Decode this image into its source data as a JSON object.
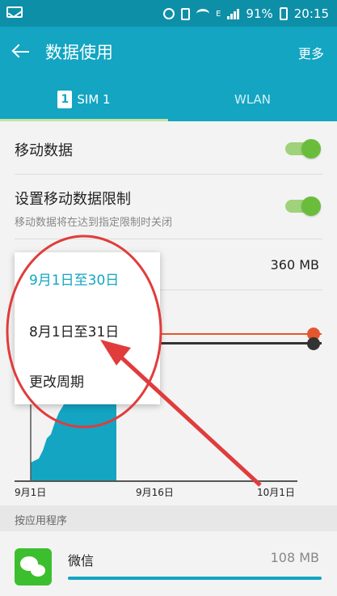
{
  "status_bar": {
    "battery": "91%",
    "time": "20:15",
    "network_letter": "E"
  },
  "app_bar": {
    "title": "数据使用",
    "more": "更多"
  },
  "tabs": [
    {
      "label": "SIM 1",
      "badge": "1",
      "active": true
    },
    {
      "label": "WLAN",
      "active": false
    }
  ],
  "settings": {
    "mobile_data": {
      "label": "移动数据",
      "enabled": true
    },
    "limit": {
      "label": "设置移动数据限制",
      "sub": "移动数据将在达到指定限制时关闭",
      "enabled": true
    }
  },
  "usage": {
    "limit_value": "360 MB"
  },
  "dropdown": {
    "items": [
      "9月1日至30日",
      "8月1日至31日",
      "更改周期"
    ],
    "selected_index": 0
  },
  "chart_data": {
    "type": "area",
    "x_labels": [
      "9月1日",
      "9月16日",
      "10月1日"
    ],
    "accent_color": "#13a5c2",
    "warning_color": "#e4572e",
    "limit_color": "#333333"
  },
  "app_section": {
    "header": "按应用程序",
    "apps": [
      {
        "name": "微信",
        "size": "108 MB",
        "icon": "wechat-icon"
      }
    ]
  }
}
